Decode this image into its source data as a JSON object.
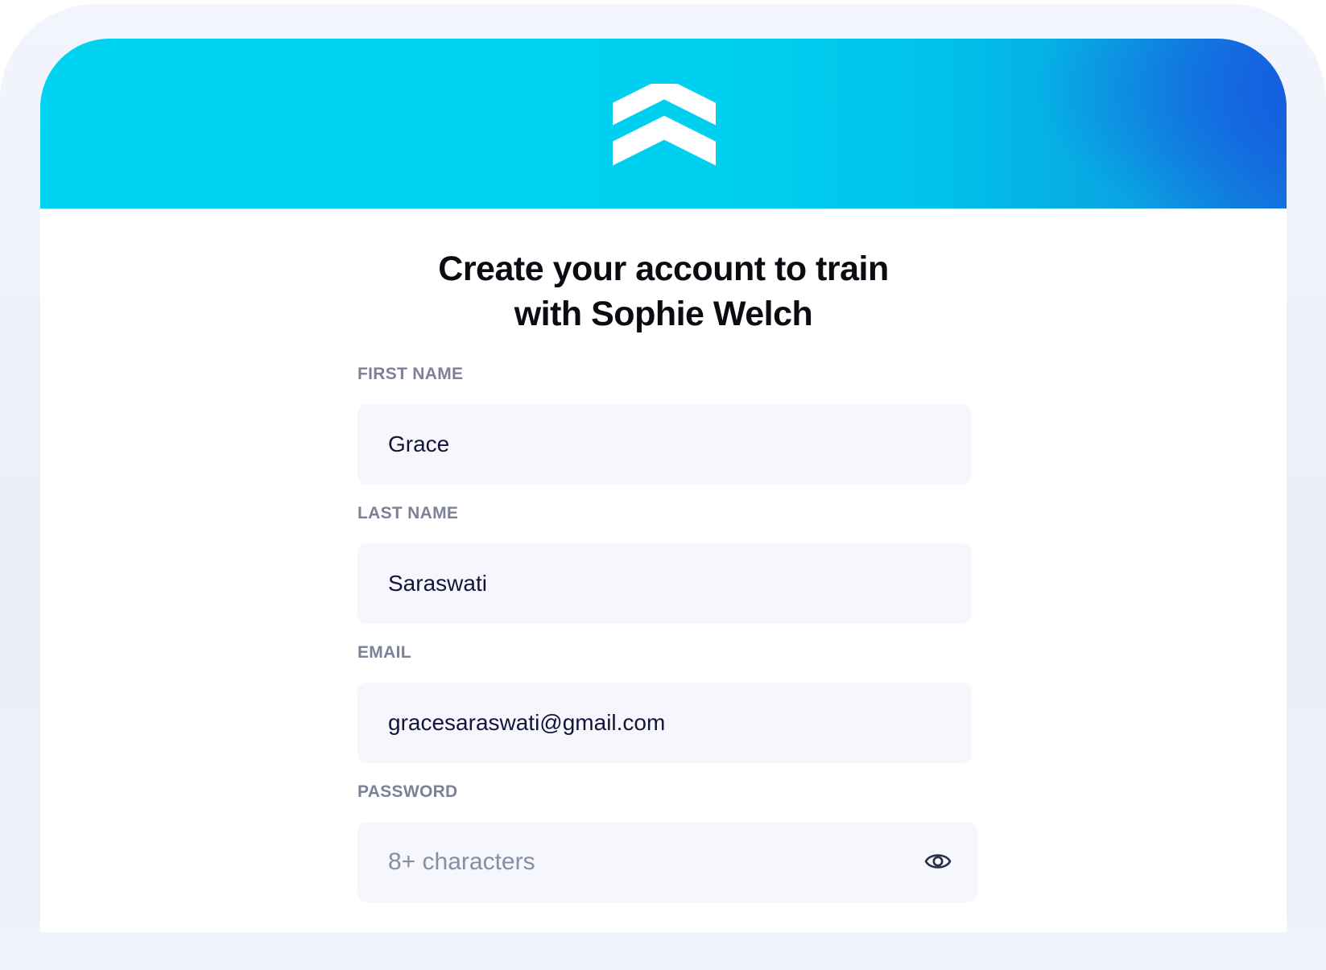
{
  "form": {
    "title_line1": "Create your account to train",
    "title_line2": "with Sophie Welch",
    "first_name": {
      "label": "FIRST NAME",
      "value": "Grace"
    },
    "last_name": {
      "label": "LAST NAME",
      "value": "Saraswati"
    },
    "email": {
      "label": "EMAIL",
      "value": "gracesaraswati@gmail.com"
    },
    "password": {
      "label": "PASSWORD",
      "placeholder": "8+ characters",
      "toggle_icon": "eye-icon"
    }
  },
  "colors": {
    "header_start": "#00d3ef",
    "header_end": "#1656e0",
    "label": "#7d8196",
    "field_bg": "#f5f7fc",
    "text": "#16133a"
  },
  "logo_icon": "double-chevron-up-icon"
}
